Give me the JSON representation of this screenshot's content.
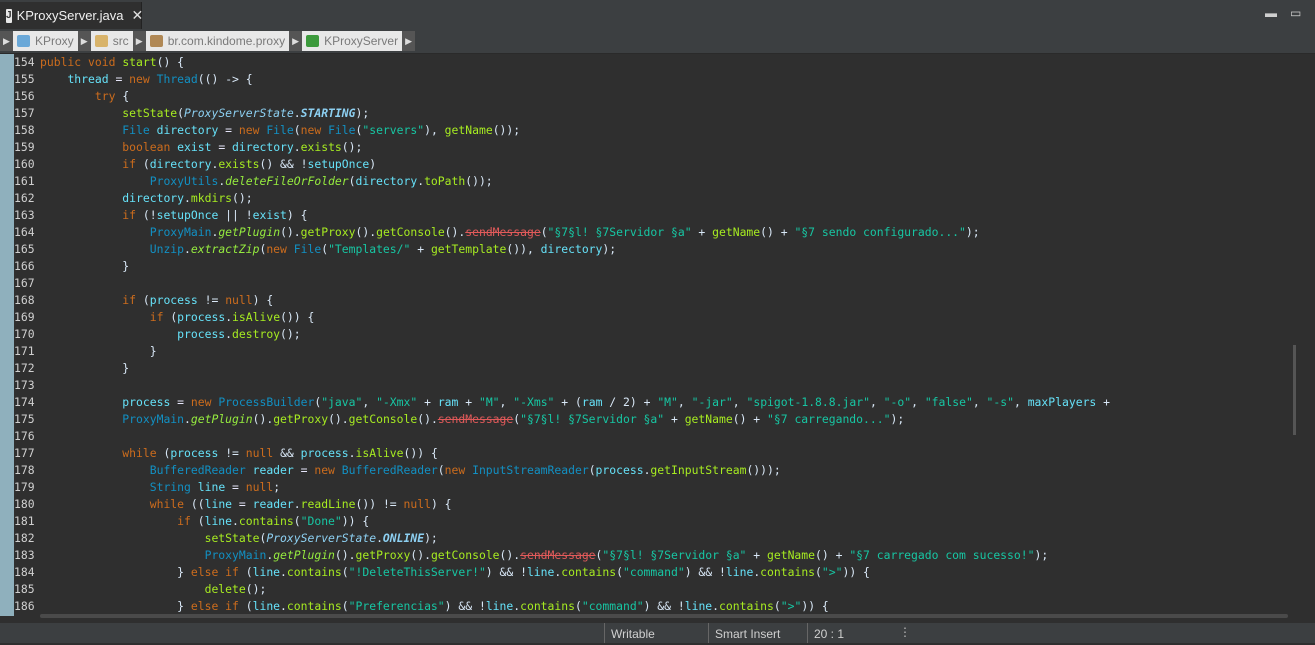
{
  "tab": {
    "icon": "J",
    "title": "KProxyServer.java",
    "close": "✕"
  },
  "window_controls": {
    "minimize": "▬",
    "maximize": "▭"
  },
  "breadcrumbs": [
    {
      "label": "KProxy",
      "icon": "project-folder-icon",
      "color": "#6aa8d8"
    },
    {
      "label": "src",
      "icon": "source-folder-icon",
      "color": "#d8b36a"
    },
    {
      "label": "br.com.kindome.proxy",
      "icon": "package-icon",
      "color": "#b08855"
    },
    {
      "label": "KProxyServer",
      "icon": "class-icon",
      "color": "#3c9a3c"
    }
  ],
  "lines": [
    {
      "n": "154",
      "s": [
        [
          "kw",
          "public "
        ],
        [
          "kw",
          "void "
        ],
        [
          "mth",
          "start"
        ],
        [
          "",
          "() {"
        ]
      ]
    },
    {
      "n": "155",
      "s": [
        [
          "",
          "    "
        ],
        [
          "fld",
          "thread "
        ],
        [
          "op",
          "= "
        ],
        [
          "kw",
          "new "
        ],
        [
          "ty",
          "Thread"
        ],
        [
          "",
          "(() -> {"
        ]
      ]
    },
    {
      "n": "156",
      "s": [
        [
          "",
          "        "
        ],
        [
          "kw",
          "try "
        ],
        [
          "",
          "{"
        ]
      ]
    },
    {
      "n": "157",
      "s": [
        [
          "",
          "            "
        ],
        [
          "mth",
          "setState"
        ],
        [
          "",
          "("
        ],
        [
          "en",
          "ProxyServerState"
        ],
        [
          "",
          "."
        ],
        [
          "cst",
          "STARTING"
        ],
        [
          "",
          ");"
        ]
      ]
    },
    {
      "n": "158",
      "s": [
        [
          "",
          "            "
        ],
        [
          "ty",
          "File "
        ],
        [
          "fld",
          "directory "
        ],
        [
          "op",
          "= "
        ],
        [
          "kw",
          "new "
        ],
        [
          "ty",
          "File"
        ],
        [
          "",
          "("
        ],
        [
          "kw",
          "new "
        ],
        [
          "ty",
          "File"
        ],
        [
          "",
          "("
        ],
        [
          "str",
          "\"servers\""
        ],
        [
          "",
          "), "
        ],
        [
          "mth",
          "getName"
        ],
        [
          "",
          "());"
        ]
      ]
    },
    {
      "n": "159",
      "s": [
        [
          "",
          "            "
        ],
        [
          "kw",
          "boolean "
        ],
        [
          "fld",
          "exist "
        ],
        [
          "op",
          "= "
        ],
        [
          "fld",
          "directory"
        ],
        [
          "",
          "."
        ],
        [
          "mth",
          "exists"
        ],
        [
          "",
          "();"
        ]
      ]
    },
    {
      "n": "160",
      "s": [
        [
          "",
          "            "
        ],
        [
          "kw",
          "if "
        ],
        [
          "",
          "("
        ],
        [
          "fld",
          "directory"
        ],
        [
          "",
          "."
        ],
        [
          "mth",
          "exists"
        ],
        [
          "",
          "() && !"
        ],
        [
          "fld",
          "setupOnce"
        ],
        [
          "",
          ")"
        ]
      ]
    },
    {
      "n": "161",
      "s": [
        [
          "",
          "                "
        ],
        [
          "ty",
          "ProxyUtils"
        ],
        [
          "",
          "."
        ],
        [
          "sm",
          "deleteFileOrFolder"
        ],
        [
          "",
          "("
        ],
        [
          "fld",
          "directory"
        ],
        [
          "",
          "."
        ],
        [
          "mth",
          "toPath"
        ],
        [
          "",
          "());"
        ]
      ]
    },
    {
      "n": "162",
      "s": [
        [
          "",
          "            "
        ],
        [
          "fld",
          "directory"
        ],
        [
          "",
          "."
        ],
        [
          "mth",
          "mkdirs"
        ],
        [
          "",
          "();"
        ]
      ]
    },
    {
      "n": "163",
      "s": [
        [
          "",
          "            "
        ],
        [
          "kw",
          "if "
        ],
        [
          "",
          "(!"
        ],
        [
          "fld",
          "setupOnce "
        ],
        [
          "",
          "|| !"
        ],
        [
          "fld",
          "exist"
        ],
        [
          "",
          ") {"
        ]
      ]
    },
    {
      "n": "164",
      "s": [
        [
          "",
          "                "
        ],
        [
          "ty",
          "ProxyMain"
        ],
        [
          "",
          "."
        ],
        [
          "sm",
          "getPlugin"
        ],
        [
          "",
          "()."
        ],
        [
          "mth",
          "getProxy"
        ],
        [
          "",
          "()."
        ],
        [
          "mth",
          "getConsole"
        ],
        [
          "",
          "()."
        ],
        [
          "dep",
          "sendMessage"
        ],
        [
          "",
          "("
        ],
        [
          "str",
          "\"§7§l! §7Servidor §a\""
        ],
        [
          "",
          " + "
        ],
        [
          "mth",
          "getName"
        ],
        [
          "",
          "() + "
        ],
        [
          "str",
          "\"§7 sendo configurado...\""
        ],
        [
          "",
          ");"
        ]
      ]
    },
    {
      "n": "165",
      "s": [
        [
          "",
          "                "
        ],
        [
          "ty",
          "Unzip"
        ],
        [
          "",
          "."
        ],
        [
          "sm",
          "extractZip"
        ],
        [
          "",
          "("
        ],
        [
          "kw",
          "new "
        ],
        [
          "ty",
          "File"
        ],
        [
          "",
          "("
        ],
        [
          "str",
          "\"Templates/\""
        ],
        [
          "",
          " + "
        ],
        [
          "mth",
          "getTemplate"
        ],
        [
          "",
          "()), "
        ],
        [
          "fld",
          "directory"
        ],
        [
          "",
          ");"
        ]
      ]
    },
    {
      "n": "166",
      "s": [
        [
          "",
          "            }"
        ]
      ]
    },
    {
      "n": "167",
      "s": [
        [
          "",
          ""
        ]
      ]
    },
    {
      "n": "168",
      "s": [
        [
          "",
          "            "
        ],
        [
          "kw",
          "if "
        ],
        [
          "",
          "("
        ],
        [
          "fld",
          "process "
        ],
        [
          "",
          "!= "
        ],
        [
          "kw",
          "null"
        ],
        [
          "",
          ") {"
        ]
      ]
    },
    {
      "n": "169",
      "s": [
        [
          "",
          "                "
        ],
        [
          "kw",
          "if "
        ],
        [
          "",
          "("
        ],
        [
          "fld",
          "process"
        ],
        [
          "",
          "."
        ],
        [
          "mth",
          "isAlive"
        ],
        [
          "",
          "()) {"
        ]
      ]
    },
    {
      "n": "170",
      "s": [
        [
          "",
          "                    "
        ],
        [
          "fld",
          "process"
        ],
        [
          "",
          "."
        ],
        [
          "mth",
          "destroy"
        ],
        [
          "",
          "();"
        ]
      ]
    },
    {
      "n": "171",
      "s": [
        [
          "",
          "                }"
        ]
      ]
    },
    {
      "n": "172",
      "s": [
        [
          "",
          "            }"
        ]
      ]
    },
    {
      "n": "173",
      "s": [
        [
          "",
          ""
        ]
      ]
    },
    {
      "n": "174",
      "s": [
        [
          "",
          "            "
        ],
        [
          "fld",
          "process "
        ],
        [
          "op",
          "= "
        ],
        [
          "kw",
          "new "
        ],
        [
          "ty",
          "ProcessBuilder"
        ],
        [
          "",
          "("
        ],
        [
          "str",
          "\"java\""
        ],
        [
          "",
          ", "
        ],
        [
          "str",
          "\"-Xmx\""
        ],
        [
          "",
          " + "
        ],
        [
          "fld",
          "ram"
        ],
        [
          "",
          " + "
        ],
        [
          "str",
          "\"M\""
        ],
        [
          "",
          ", "
        ],
        [
          "str",
          "\"-Xms\""
        ],
        [
          "",
          " + ("
        ],
        [
          "fld",
          "ram"
        ],
        [
          "",
          " / 2) + "
        ],
        [
          "str",
          "\"M\""
        ],
        [
          "",
          ", "
        ],
        [
          "str",
          "\"-jar\""
        ],
        [
          "",
          ", "
        ],
        [
          "str",
          "\"spigot-1.8.8.jar\""
        ],
        [
          "",
          ", "
        ],
        [
          "str",
          "\"-o\""
        ],
        [
          "",
          ", "
        ],
        [
          "str",
          "\"false\""
        ],
        [
          "",
          ", "
        ],
        [
          "str",
          "\"-s\""
        ],
        [
          "",
          ", "
        ],
        [
          "fld",
          "maxPlayers"
        ],
        [
          "",
          " +"
        ]
      ]
    },
    {
      "n": "175",
      "s": [
        [
          "",
          "            "
        ],
        [
          "ty",
          "ProxyMain"
        ],
        [
          "",
          "."
        ],
        [
          "sm",
          "getPlugin"
        ],
        [
          "",
          "()."
        ],
        [
          "mth",
          "getProxy"
        ],
        [
          "",
          "()."
        ],
        [
          "mth",
          "getConsole"
        ],
        [
          "",
          "()."
        ],
        [
          "dep",
          "sendMessage"
        ],
        [
          "",
          "("
        ],
        [
          "str",
          "\"§7§l! §7Servidor §a\""
        ],
        [
          "",
          " + "
        ],
        [
          "mth",
          "getName"
        ],
        [
          "",
          "() + "
        ],
        [
          "str",
          "\"§7 carregando...\""
        ],
        [
          "",
          ");"
        ]
      ]
    },
    {
      "n": "176",
      "s": [
        [
          "",
          ""
        ]
      ]
    },
    {
      "n": "177",
      "s": [
        [
          "",
          "            "
        ],
        [
          "kw",
          "while "
        ],
        [
          "",
          "("
        ],
        [
          "fld",
          "process "
        ],
        [
          "",
          "!= "
        ],
        [
          "kw",
          "null "
        ],
        [
          "",
          "&& "
        ],
        [
          "fld",
          "process"
        ],
        [
          "",
          "."
        ],
        [
          "mth",
          "isAlive"
        ],
        [
          "",
          "()) {"
        ]
      ]
    },
    {
      "n": "178",
      "s": [
        [
          "",
          "                "
        ],
        [
          "ty",
          "BufferedReader "
        ],
        [
          "fld",
          "reader "
        ],
        [
          "op",
          "= "
        ],
        [
          "kw",
          "new "
        ],
        [
          "ty",
          "BufferedReader"
        ],
        [
          "",
          "("
        ],
        [
          "kw",
          "new "
        ],
        [
          "ty",
          "InputStreamReader"
        ],
        [
          "",
          "("
        ],
        [
          "fld",
          "process"
        ],
        [
          "",
          "."
        ],
        [
          "mth",
          "getInputStream"
        ],
        [
          "",
          "()));"
        ]
      ]
    },
    {
      "n": "179",
      "s": [
        [
          "",
          "                "
        ],
        [
          "ty",
          "String "
        ],
        [
          "fld",
          "line "
        ],
        [
          "op",
          "= "
        ],
        [
          "kw",
          "null"
        ],
        [
          "",
          ";"
        ]
      ]
    },
    {
      "n": "180",
      "s": [
        [
          "",
          "                "
        ],
        [
          "kw",
          "while "
        ],
        [
          "",
          "(("
        ],
        [
          "fld",
          "line "
        ],
        [
          "op",
          "= "
        ],
        [
          "fld",
          "reader"
        ],
        [
          "",
          "."
        ],
        [
          "mth",
          "readLine"
        ],
        [
          "",
          "()) != "
        ],
        [
          "kw",
          "null"
        ],
        [
          "",
          ") {"
        ]
      ]
    },
    {
      "n": "181",
      "s": [
        [
          "",
          "                    "
        ],
        [
          "kw",
          "if "
        ],
        [
          "",
          "("
        ],
        [
          "fld",
          "line"
        ],
        [
          "",
          "."
        ],
        [
          "mth",
          "contains"
        ],
        [
          "",
          "("
        ],
        [
          "str",
          "\"Done\""
        ],
        [
          "",
          ")) {"
        ]
      ]
    },
    {
      "n": "182",
      "s": [
        [
          "",
          "                        "
        ],
        [
          "mth",
          "setState"
        ],
        [
          "",
          "("
        ],
        [
          "en",
          "ProxyServerState"
        ],
        [
          "",
          "."
        ],
        [
          "cst",
          "ONLINE"
        ],
        [
          "",
          ");"
        ]
      ]
    },
    {
      "n": "183",
      "s": [
        [
          "",
          "                        "
        ],
        [
          "ty",
          "ProxyMain"
        ],
        [
          "",
          "."
        ],
        [
          "sm",
          "getPlugin"
        ],
        [
          "",
          "()."
        ],
        [
          "mth",
          "getProxy"
        ],
        [
          "",
          "()."
        ],
        [
          "mth",
          "getConsole"
        ],
        [
          "",
          "()."
        ],
        [
          "dep",
          "sendMessage"
        ],
        [
          "",
          "("
        ],
        [
          "str",
          "\"§7§l! §7Servidor §a\""
        ],
        [
          "",
          " + "
        ],
        [
          "mth",
          "getName"
        ],
        [
          "",
          "() + "
        ],
        [
          "str",
          "\"§7 carregado com sucesso!\""
        ],
        [
          "",
          ");"
        ]
      ]
    },
    {
      "n": "184",
      "s": [
        [
          "",
          "                    } "
        ],
        [
          "kw",
          "else if "
        ],
        [
          "",
          "("
        ],
        [
          "fld",
          "line"
        ],
        [
          "",
          "."
        ],
        [
          "mth",
          "contains"
        ],
        [
          "",
          "("
        ],
        [
          "str",
          "\"!DeleteThisServer!\""
        ],
        [
          "",
          ") && !"
        ],
        [
          "fld",
          "line"
        ],
        [
          "",
          "."
        ],
        [
          "mth",
          "contains"
        ],
        [
          "",
          "("
        ],
        [
          "str",
          "\"command\""
        ],
        [
          "",
          ") && !"
        ],
        [
          "fld",
          "line"
        ],
        [
          "",
          "."
        ],
        [
          "mth",
          "contains"
        ],
        [
          "",
          "("
        ],
        [
          "str",
          "\">\""
        ],
        [
          "",
          ")) {"
        ]
      ]
    },
    {
      "n": "185",
      "s": [
        [
          "",
          "                        "
        ],
        [
          "mth",
          "delete"
        ],
        [
          "",
          "();"
        ]
      ]
    },
    {
      "n": "186",
      "s": [
        [
          "",
          "                    } "
        ],
        [
          "kw",
          "else if "
        ],
        [
          "",
          "("
        ],
        [
          "fld",
          "line"
        ],
        [
          "",
          "."
        ],
        [
          "mth",
          "contains"
        ],
        [
          "",
          "("
        ],
        [
          "str",
          "\"Preferencias\""
        ],
        [
          "",
          ") && !"
        ],
        [
          "fld",
          "line"
        ],
        [
          "",
          "."
        ],
        [
          "mth",
          "contains"
        ],
        [
          "",
          "("
        ],
        [
          "str",
          "\"command\""
        ],
        [
          "",
          ") && !"
        ],
        [
          "fld",
          "line"
        ],
        [
          "",
          "."
        ],
        [
          "mth",
          "contains"
        ],
        [
          "",
          "("
        ],
        [
          "str",
          "\">\""
        ],
        [
          "",
          ")) {"
        ]
      ]
    }
  ],
  "status": {
    "writable": "Writable",
    "insert_mode": "Smart Insert",
    "position": "20 : 1",
    "more": "⋮"
  }
}
